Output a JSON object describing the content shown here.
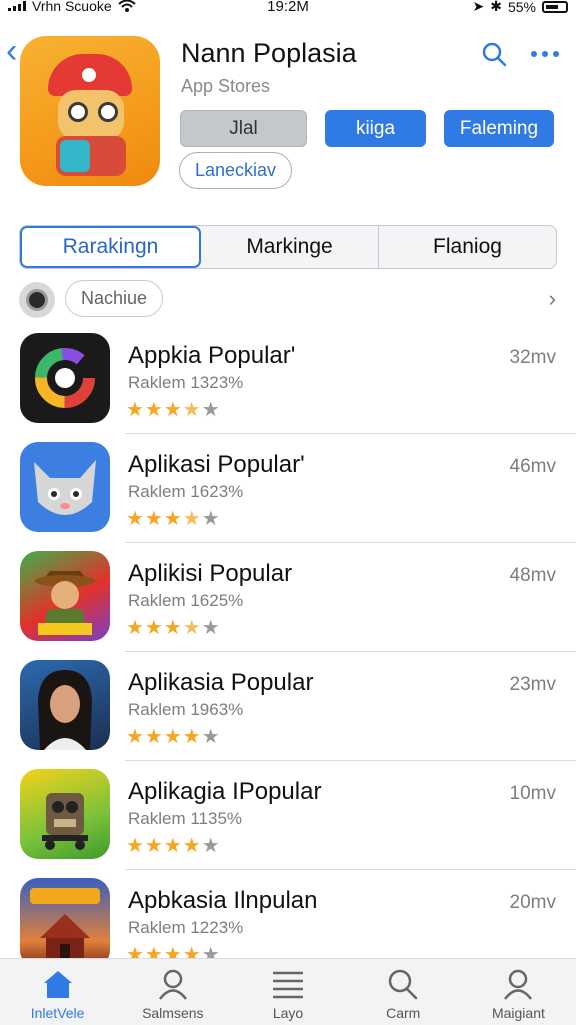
{
  "status_bar": {
    "carrier": "Vrhn Scuoke",
    "time": "19:2M",
    "battery": "55%"
  },
  "header": {
    "title": "Nann Poplasia",
    "subtitle": "App Stores",
    "buttons": [
      "Jlal",
      "kiiga",
      "Faleming"
    ],
    "outline_button": "Laneckiav"
  },
  "segments": {
    "items": [
      "Rarakingn",
      "Markinge",
      "Flaniog"
    ],
    "active_index": 0
  },
  "filter": {
    "chip": "Nachiue"
  },
  "apps": [
    {
      "name": "Appkia Popular'",
      "meta": "Raklem 1323%",
      "size": "32mv",
      "rating": 3.5
    },
    {
      "name": "Aplikasi Popular'",
      "meta": "Raklem 1623%",
      "size": "46mv",
      "rating": 3.5
    },
    {
      "name": "Aplikisi Popular",
      "meta": "Raklem 1625%",
      "size": "48mv",
      "rating": 3.5
    },
    {
      "name": "Aplikasia Popular",
      "meta": "Raklem 1963%",
      "size": "23mv",
      "rating": 4
    },
    {
      "name": "Aplikagia IPopular",
      "meta": "Raklem 1135%",
      "size": "10mv",
      "rating": 4
    },
    {
      "name": "Apbkasia Ilnpulan",
      "meta": "Raklem 1223%",
      "size": "20mv",
      "rating": 4
    }
  ],
  "tabbar": {
    "tabs": [
      {
        "label": "InletVele",
        "icon": "home-icon"
      },
      {
        "label": "Salmsens",
        "icon": "person-icon"
      },
      {
        "label": "Layo",
        "icon": "list-icon"
      },
      {
        "label": "Carm",
        "icon": "search-icon"
      },
      {
        "label": "Maigiant",
        "icon": "person-icon"
      }
    ],
    "active_index": 0
  },
  "colors": {
    "accent": "#2f7ae5",
    "star": "#f5a623"
  }
}
